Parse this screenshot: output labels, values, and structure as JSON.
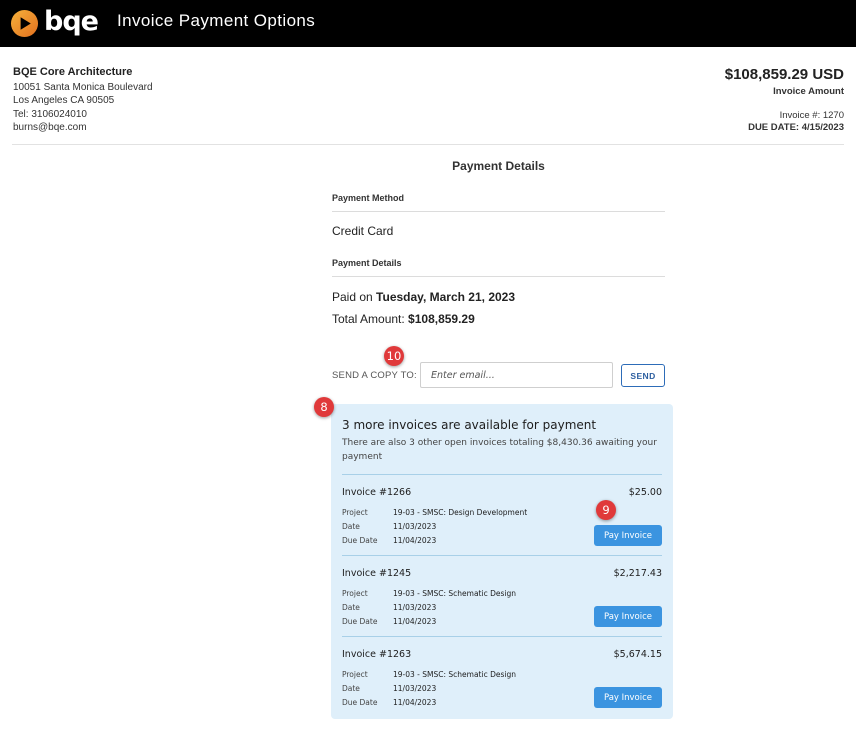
{
  "header": {
    "logo_text": "bqe",
    "title": "Invoice Payment Options"
  },
  "company": {
    "name": "BQE Core Architecture",
    "address1": "10051 Santa Monica Boulevard",
    "address2": "Los Angeles CA 90505",
    "tel": "Tel: 3106024010",
    "email": "burns@bqe.com"
  },
  "invoice_summary": {
    "amount": "$108,859.29 USD",
    "amount_label": "Invoice Amount",
    "invoice_number": "Invoice #: 1270",
    "due_date": "DUE DATE: 4/15/2023"
  },
  "payment": {
    "title": "Payment Details",
    "method_label": "Payment Method",
    "method_value": "Credit Card",
    "details_label": "Payment Details",
    "paid_prefix": "Paid on ",
    "paid_date": "Tuesday, March 21, 2023",
    "total_prefix": "Total Amount: ",
    "total_value": "$108,859.29"
  },
  "send_copy": {
    "label": "SEND A COPY TO:",
    "placeholder": "Enter email...",
    "button": "SEND"
  },
  "badges": {
    "b8": "8",
    "b9": "9",
    "b10": "10"
  },
  "more_invoices": {
    "title": "3 more invoices are available for payment",
    "description": "There are also 3 other open invoices totaling $8,430.36 awaiting your payment",
    "field_labels": {
      "project": "Project",
      "date": "Date",
      "due": "Due Date"
    },
    "pay_label": "Pay Invoice",
    "items": [
      {
        "number": "Invoice #1266",
        "amount": "$25.00",
        "project": "19-03 - SMSC: Design Development",
        "date": "11/03/2023",
        "due": "11/04/2023"
      },
      {
        "number": "Invoice #1245",
        "amount": "$2,217.43",
        "project": "19-03 - SMSC: Schematic Design",
        "date": "11/03/2023",
        "due": "11/04/2023"
      },
      {
        "number": "Invoice #1263",
        "amount": "$5,674.15",
        "project": "19-03 - SMSC: Schematic Design",
        "date": "11/03/2023",
        "due": "11/04/2023"
      }
    ]
  },
  "colors": {
    "topbar": "#000000",
    "brand_orange": "#f39c2c",
    "panel": "#dfeffa",
    "button_blue": "#3b94e0",
    "badge_red": "#e0393a"
  }
}
